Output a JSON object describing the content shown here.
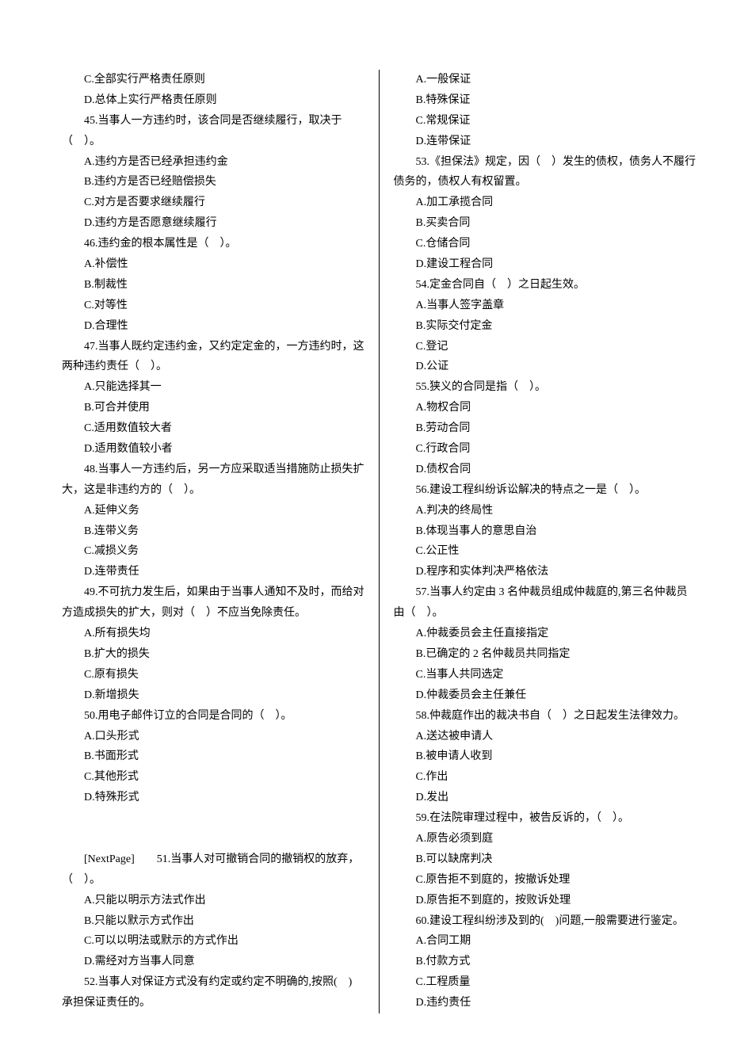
{
  "left": [
    "C.全部实行严格责任原则",
    "D.总体上实行严格责任原则",
    "45.当事人一方违约时，该合同是否继续履行，取决于",
    "（　）。",
    "A.违约方是否已经承担违约金",
    "B.违约方是否已经赔偿损失",
    "C.对方是否要求继续履行",
    "D.违约方是否愿意继续履行",
    "46.违约金的根本属性是（　）。",
    "A.补偿性",
    "B.制裁性",
    "C.对等性",
    "D.合理性",
    "47.当事人既约定违约金，又约定定金的，一方违约时，这",
    "两种违约责任（　）。",
    "A.只能选择其一",
    "B.可合并使用",
    "C.适用数值较大者",
    "D.适用数值较小者",
    "48.当事人一方违约后，另一方应采取适当措施防止损失扩",
    "大，这是非违约方的（　）。",
    "A.延伸义务",
    "B.连带义务",
    "C.减损义务",
    "D.连带责任",
    "49.不可抗力发生后，如果由于当事人通知不及时，而给对",
    "方造成损失的扩大，则对（　）不应当免除责任。",
    "A.所有损失均",
    "B.扩大的损失",
    "C.原有损失",
    "D.新增损失",
    "50.用电子邮件订立的合同是合同的（　）。",
    "A.口头形式",
    "B.书面形式",
    "C.其他形式",
    "D.特殊形式",
    "",
    "",
    "[NextPage]　　51.当事人对可撤销合同的撤销权的放弃，",
    "（　）。",
    "A.只能以明示方法式作出",
    "B.只能以默示方式作出",
    "C.可以以明法或默示的方式作出",
    "D.需经对方当事人同意",
    "52.当事人对保证方式没有约定或约定不明确的,按照(　)",
    "承担保证责任的。"
  ],
  "right": [
    "A.一般保证",
    "B.特殊保证",
    "C.常规保证",
    "D.连带保证",
    "53.《担保法》规定，因（　）发生的债权，债务人不履行",
    "债务的，债权人有权留置。",
    "A.加工承揽合同",
    "B.买卖合同",
    "C.仓储合同",
    "D.建设工程合同",
    "54.定金合同自（　）之日起生效。",
    "A.当事人签字盖章",
    "B.实际交付定金",
    "C.登记",
    "D.公证",
    "55.狭义的合同是指（　）。",
    "A.物权合同",
    "B.劳动合同",
    "C.行政合同",
    "D.债权合同",
    "56.建设工程纠纷诉讼解决的特点之一是（　）。",
    "A.判决的终局性",
    "B.体现当事人的意思自治",
    "C.公正性",
    "D.程序和实体判决严格依法",
    "57.当事人约定由 3 名仲裁员组成仲裁庭的,第三名仲裁员",
    "由（　）。",
    "A.仲裁委员会主任直接指定",
    "B.已确定的 2 名仲裁员共同指定",
    "C.当事人共同选定",
    "D.仲裁委员会主任兼任",
    "58.仲裁庭作出的裁决书自（　）之日起发生法律效力。",
    "A.送达被申请人",
    "B.被申请人收到",
    "C.作出",
    "D.发出",
    "59.在法院审理过程中，被告反诉的，（　）。",
    "A.原告必须到庭",
    "B.可以缺席判决",
    "C.原告拒不到庭的，按撤诉处理",
    "D.原告拒不到庭的，按败诉处理",
    "60.建设工程纠纷涉及到的(　)问题,一般需要进行鉴定。",
    "A.合同工期",
    "B.付款方式",
    "C.工程质量",
    "D.违约责任"
  ],
  "leftCont": [
    3,
    14,
    20,
    26,
    39,
    45
  ],
  "rightCont": [
    5,
    26
  ]
}
